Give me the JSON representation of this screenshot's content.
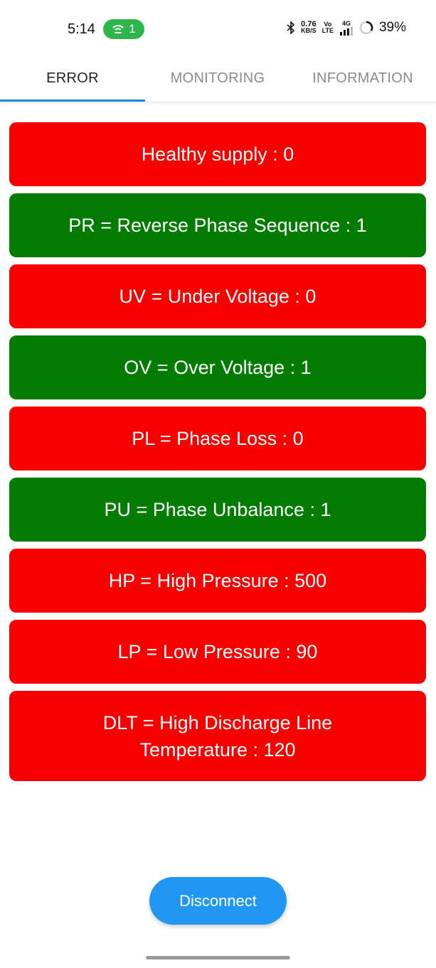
{
  "status_bar": {
    "time": "5:14",
    "hotspot_count": "1",
    "net_speed_top": "0.76",
    "net_speed_bottom": "KB/S",
    "volte_top": "Vo",
    "volte_bottom": "LTE",
    "network_type": "4G",
    "battery": "39%"
  },
  "tabs": [
    {
      "label": "ERROR",
      "active": true
    },
    {
      "label": "MONITORING",
      "active": false
    },
    {
      "label": "INFORMATION",
      "active": false
    }
  ],
  "errors": [
    {
      "label": "Healthy supply : 0",
      "color": "#f90000"
    },
    {
      "label": "PR = Reverse Phase Sequence : 1",
      "color": "#047c04"
    },
    {
      "label": "UV = Under Voltage : 0",
      "color": "#f90000"
    },
    {
      "label": "OV = Over Voltage : 1",
      "color": "#047c04"
    },
    {
      "label": "PL = Phase Loss : 0",
      "color": "#f90000"
    },
    {
      "label": "PU = Phase Unbalance : 1",
      "color": "#047c04"
    },
    {
      "label": "HP = High Pressure : 500",
      "color": "#f90000"
    },
    {
      "label": "LP = Low Pressure : 90",
      "color": "#f90000"
    },
    {
      "label_line1": "DLT = High Discharge Line",
      "label_line2": "Temperature : 120",
      "color": "#f90000"
    }
  ],
  "disconnect_label": "Disconnect",
  "colors": {
    "accent": "#2196f3",
    "error_red": "#f90000",
    "ok_green": "#047c04"
  }
}
